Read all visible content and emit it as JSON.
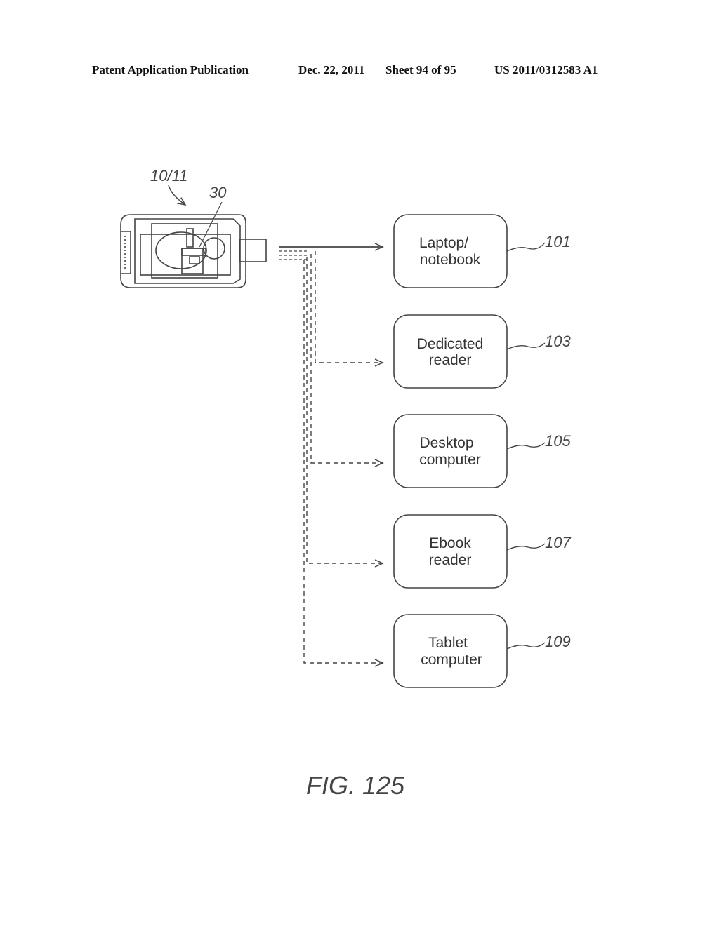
{
  "header": {
    "publication": "Patent Application Publication",
    "date": "Dec. 22, 2011",
    "sheet": "Sheet 94 of 95",
    "number": "US 2011/0312583 A1"
  },
  "device": {
    "label": "10/11",
    "component_label": "30"
  },
  "targets": [
    {
      "line1": "Laptop/",
      "line2": "notebook",
      "ref": "101",
      "link": "solid"
    },
    {
      "line1": "Dedicated",
      "line2": "reader",
      "ref": "103",
      "link": "dashed"
    },
    {
      "line1": "Desktop",
      "line2": "computer",
      "ref": "105",
      "link": "dashed"
    },
    {
      "line1": "Ebook",
      "line2": "reader",
      "ref": "107",
      "link": "dashed"
    },
    {
      "line1": "Tablet",
      "line2": "computer",
      "ref": "109",
      "link": "dashed"
    }
  ],
  "figure_caption": "FIG. 125"
}
